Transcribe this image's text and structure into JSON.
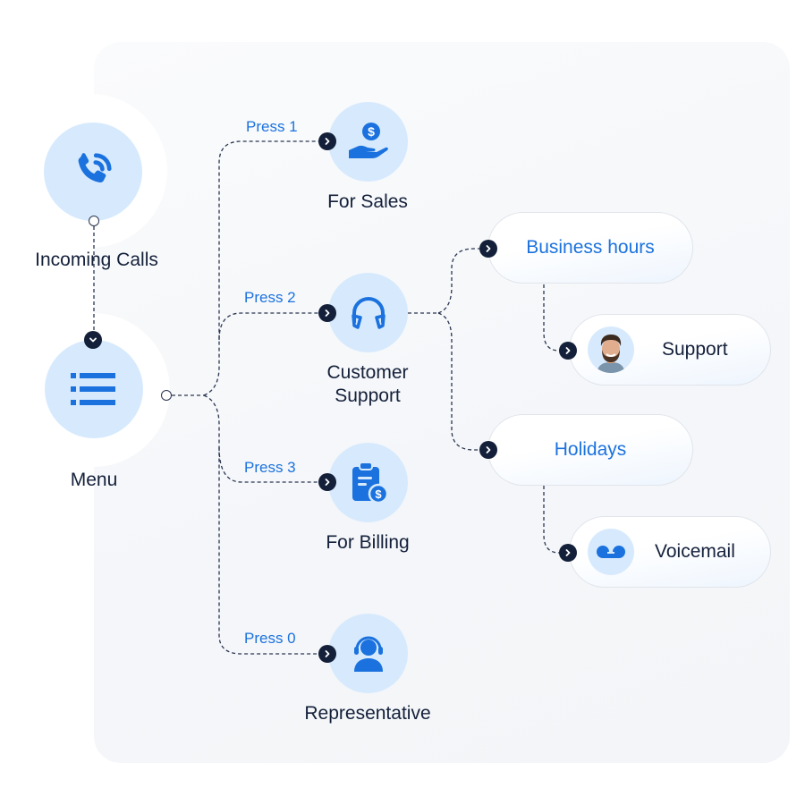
{
  "colors": {
    "accent_blue": "#1b72de",
    "node_fill": "#d7eafd",
    "dark_navy": "#14203a",
    "panel_bg": "#f4f6f9"
  },
  "diagram": {
    "incoming": {
      "label": "Incoming Calls",
      "icon": "phone-ringing-icon"
    },
    "menu": {
      "label": "Menu",
      "icon": "list-icon"
    },
    "options": [
      {
        "press": "Press 1",
        "label": "For Sales",
        "icon": "hand-dollar-icon"
      },
      {
        "press": "Press 2",
        "label_line1": "Customer",
        "label_line2": "Support",
        "icon": "headphones-icon"
      },
      {
        "press": "Press 3",
        "label": "For Billing",
        "icon": "clipboard-dollar-icon"
      },
      {
        "press": "Press 0",
        "label": "Representative",
        "icon": "agent-headset-icon"
      }
    ],
    "routing": [
      {
        "condition": "Business hours",
        "target": "Support",
        "target_icon": "agent-avatar"
      },
      {
        "condition": "Holidays",
        "target": "Voicemail",
        "target_icon": "voicemail-icon"
      }
    ]
  }
}
